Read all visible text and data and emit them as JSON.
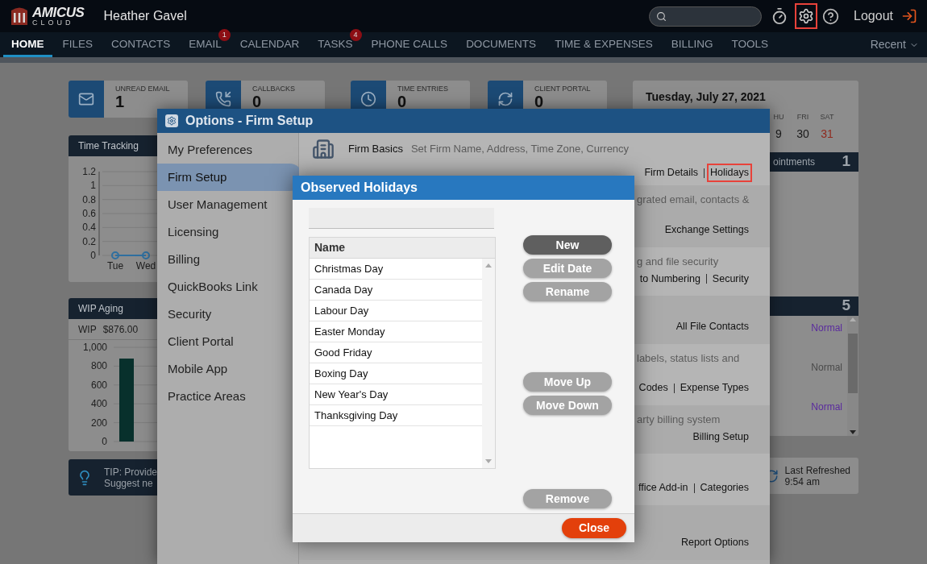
{
  "header": {
    "logo_top": "AMICUS",
    "logo_bottom": "CLOUD",
    "user": "Heather Gavel",
    "settings_highlighted": true,
    "logout": "Logout"
  },
  "nav": [
    {
      "label": "HOME",
      "selected": true
    },
    {
      "label": "FILES",
      "selected": false
    },
    {
      "label": "CONTACTS",
      "selected": false
    },
    {
      "label": "EMAIL",
      "selected": false,
      "badge": "1"
    },
    {
      "label": "CALENDAR",
      "selected": false
    },
    {
      "label": "TASKS",
      "selected": false,
      "badge": "4"
    },
    {
      "label": "PHONE CALLS",
      "selected": false
    },
    {
      "label": "DOCUMENTS",
      "selected": false
    },
    {
      "label": "TIME & EXPENSES",
      "selected": false
    },
    {
      "label": "BILLING",
      "selected": false
    },
    {
      "label": "TOOLS",
      "selected": false
    }
  ],
  "recent": "Recent",
  "stats": [
    {
      "kind": "email",
      "label": "UNREAD EMAIL",
      "value": "1"
    },
    {
      "kind": "callbacks",
      "label": "CALLBACKS",
      "value": "0"
    },
    {
      "kind": "time",
      "label": "TIME ENTRIES",
      "value": "0"
    },
    {
      "kind": "portal",
      "label": "CLIENT PORTAL",
      "value": "0"
    }
  ],
  "time_tracking": {
    "title": "Time Tracking",
    "chart_data": {
      "type": "line",
      "grid": true,
      "x": [
        "Tue",
        "Wed"
      ],
      "series": [
        {
          "color": "#2f6f9f",
          "marker": true,
          "values": [
            0,
            0
          ]
        }
      ],
      "ylim": [
        0,
        1.2
      ],
      "yticks": [
        0,
        0.2,
        0.4,
        0.6,
        0.8,
        1,
        1.2
      ]
    }
  },
  "wip": {
    "title": "WIP Aging",
    "label": "WIP",
    "amount": "$876.00",
    "chart_data": {
      "type": "bar",
      "grid": true,
      "series": [
        {
          "color": "#08302c",
          "values": [
            880
          ]
        }
      ],
      "ylim": [
        0,
        1000
      ],
      "yticks": [
        {
          "value": 0,
          "label": "0"
        },
        {
          "value": 200,
          "label": "200"
        },
        {
          "value": 400,
          "label": "400"
        },
        {
          "value": 600,
          "label": "600"
        },
        {
          "value": 800,
          "label": "800"
        },
        {
          "value": 1000,
          "label": "1,000"
        }
      ]
    }
  },
  "tip": {
    "line1": "TIP: Provide",
    "line2": "Suggest ne"
  },
  "calendar": {
    "date": "Tuesday, July 27, 2021",
    "days": [
      {
        "label": "HU",
        "date": "9",
        "weekend": false
      },
      {
        "label": "FRI",
        "date": "30",
        "weekend": false
      },
      {
        "label": "SAT",
        "date": "31",
        "weekend": true
      }
    ]
  },
  "appointments": {
    "title": "ointments",
    "count": "1"
  },
  "tasks": {
    "count": "5",
    "items": [
      {
        "priority": "Normal",
        "color": "#5a2a9e"
      },
      {
        "priority": "Normal",
        "color": "#4a4a4a"
      },
      {
        "priority": "Normal",
        "color": "#5a2a9e"
      }
    ]
  },
  "refresh": {
    "line1": "Last Refreshed",
    "line2": "9:54 am"
  },
  "options": {
    "title": "Options - Firm Setup",
    "menu": [
      {
        "label": "My Preferences",
        "selected": false
      },
      {
        "label": "Firm Setup",
        "selected": true
      },
      {
        "label": "User Management",
        "selected": false
      },
      {
        "label": "Licensing",
        "selected": false
      },
      {
        "label": "Billing",
        "selected": false
      },
      {
        "label": "QuickBooks Link",
        "selected": false
      },
      {
        "label": "Security",
        "selected": false
      },
      {
        "label": "Client Portal",
        "selected": false
      },
      {
        "label": "Mobile App",
        "selected": false
      },
      {
        "label": "Practice Areas",
        "selected": false
      }
    ],
    "sections": [
      {
        "kind": "basics",
        "title": "Firm Basics",
        "description": "Set Firm Name, Address, Time Zone, Currency",
        "links": [
          {
            "label": "Firm Details",
            "selected": false
          },
          {
            "label": "Holidays",
            "selected": true
          }
        ]
      },
      {
        "kind": "plain",
        "description": "grated email, contacts &",
        "links": [
          {
            "label": "Exchange Settings",
            "selected": false
          }
        ]
      },
      {
        "kind": "plain",
        "description": "g and file security",
        "links": [
          {
            "label": "to Numbering",
            "selected": false
          },
          {
            "label": "Security",
            "selected": false
          }
        ]
      },
      {
        "kind": "plain",
        "links": [
          {
            "label": "All File Contacts",
            "selected": false
          }
        ]
      },
      {
        "kind": "plain",
        "description": "labels, status lists and",
        "links": [
          {
            "label": "Codes",
            "selected": false
          },
          {
            "label": "Expense Types",
            "selected": false
          }
        ]
      },
      {
        "kind": "plain",
        "description": "arty billing system",
        "links": [
          {
            "label": "Billing Setup",
            "selected": false
          }
        ]
      },
      {
        "kind": "plain",
        "links": [
          {
            "label": "ffice Add-in",
            "selected": false
          },
          {
            "label": "Categories",
            "selected": false
          }
        ]
      },
      {
        "kind": "plain",
        "links": [
          {
            "label": "Report Options",
            "selected": false
          }
        ]
      }
    ]
  },
  "holidays": {
    "title": "Observed Holidays",
    "column": "Name",
    "rows": [
      "Christmas Day",
      "Canada Day",
      "Labour Day",
      "Easter Monday",
      "Good Friday",
      "Boxing Day",
      "New Year's Day",
      "Thanksgiving Day"
    ],
    "button_groups": [
      [
        {
          "label": "New",
          "disabled": false
        },
        {
          "label": "Edit Date",
          "disabled": true
        },
        {
          "label": "Rename",
          "disabled": true
        }
      ],
      [
        {
          "label": "Move Up",
          "disabled": true
        },
        {
          "label": "Move Down",
          "disabled": true
        }
      ],
      [
        {
          "label": "Remove",
          "disabled": true
        }
      ]
    ],
    "close": "Close"
  }
}
